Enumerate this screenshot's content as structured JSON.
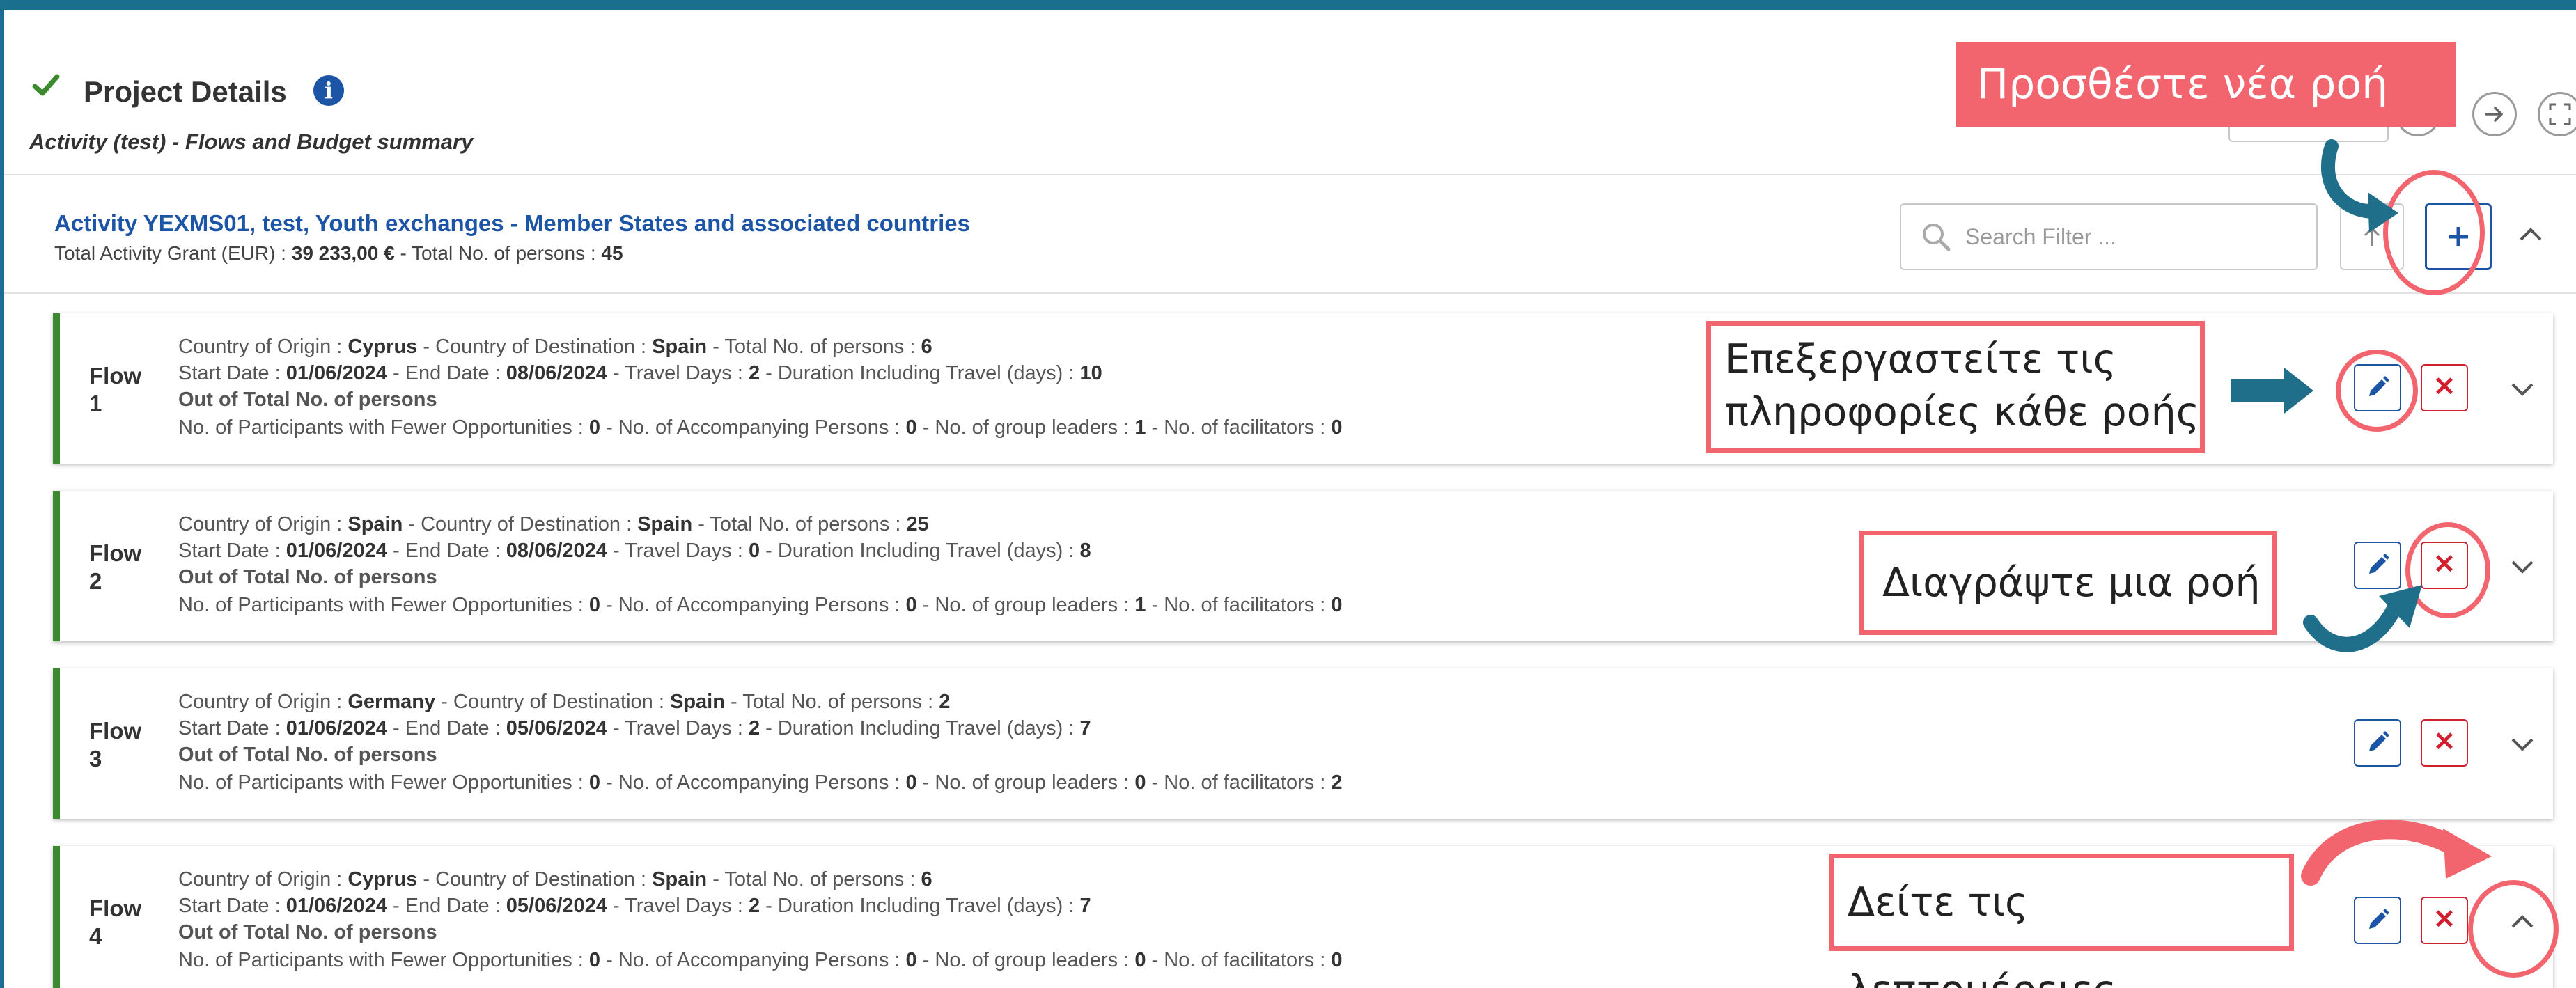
{
  "header": {
    "title": "Project Details",
    "subtitle": "Activity (test) - Flows and Budget summary"
  },
  "activity": {
    "title": "Activity YEXMS01, test, Youth exchanges - Member States and associated countries",
    "grant_label": "Total Activity Grant (EUR) : ",
    "grant_value": "39 233,00 €",
    "persons_label": " - Total No. of persons : ",
    "persons_value": "45",
    "search_placeholder": "Search Filter ..."
  },
  "labels": {
    "flow": "Flow",
    "origin": "Country of Origin : ",
    "destination": " - Country of Destination : ",
    "total_persons": " - Total No. of persons : ",
    "start": "Start Date : ",
    "end": " - End Date : ",
    "travel_days": " - Travel Days : ",
    "duration": " - Duration Including Travel (days) : ",
    "out_of": "Out of Total No. of persons",
    "fewer_opp": "No. of Participants with Fewer Opportunities : ",
    "accompanying": " - No. of Accompanying Persons : ",
    "group_leaders": " - No. of group leaders : ",
    "facilitators": " - No. of facilitators : "
  },
  "flows": [
    {
      "num": "1",
      "origin": "Cyprus",
      "destination": "Spain",
      "total": "6",
      "start": "01/06/2024",
      "end": "08/06/2024",
      "travel": "2",
      "duration": "10",
      "fewer": "0",
      "accompanying": "0",
      "leaders": "1",
      "facilitators": "0"
    },
    {
      "num": "2",
      "origin": "Spain",
      "destination": "Spain",
      "total": "25",
      "start": "01/06/2024",
      "end": "08/06/2024",
      "travel": "0",
      "duration": "8",
      "fewer": "0",
      "accompanying": "0",
      "leaders": "1",
      "facilitators": "0"
    },
    {
      "num": "3",
      "origin": "Germany",
      "destination": "Spain",
      "total": "2",
      "start": "01/06/2024",
      "end": "05/06/2024",
      "travel": "2",
      "duration": "7",
      "fewer": "0",
      "accompanying": "0",
      "leaders": "0",
      "facilitators": "2"
    },
    {
      "num": "4",
      "origin": "Cyprus",
      "destination": "Spain",
      "total": "6",
      "start": "01/06/2024",
      "end": "05/06/2024",
      "travel": "2",
      "duration": "7",
      "fewer": "0",
      "accompanying": "0",
      "leaders": "0",
      "facilitators": "0"
    }
  ],
  "callouts": {
    "add_flow": "Προσθέστε νέα ροή",
    "edit_flow_line1": "Επεξεργαστείτε τις",
    "edit_flow_line2": "πληροφορίες κάθε ροής",
    "delete_flow": "Διαγράψτε μια ροή",
    "view_details": "Δείτε τις λεπτομέρειες"
  },
  "colors": {
    "frame": "#1a6e8e",
    "accent_blue": "#1d55a6",
    "flow_bar_green": "#3c8a2e",
    "delete_red": "#d11f2e",
    "callout_pink": "#f2656f",
    "arrow_teal": "#1f6f8b"
  },
  "icons": [
    "check-icon",
    "info-icon",
    "arrow-right-icon",
    "expand-icon",
    "search-icon",
    "arrow-up-icon",
    "plus-icon",
    "chevron-up-icon",
    "pencil-icon",
    "close-icon",
    "chevron-down-icon"
  ]
}
